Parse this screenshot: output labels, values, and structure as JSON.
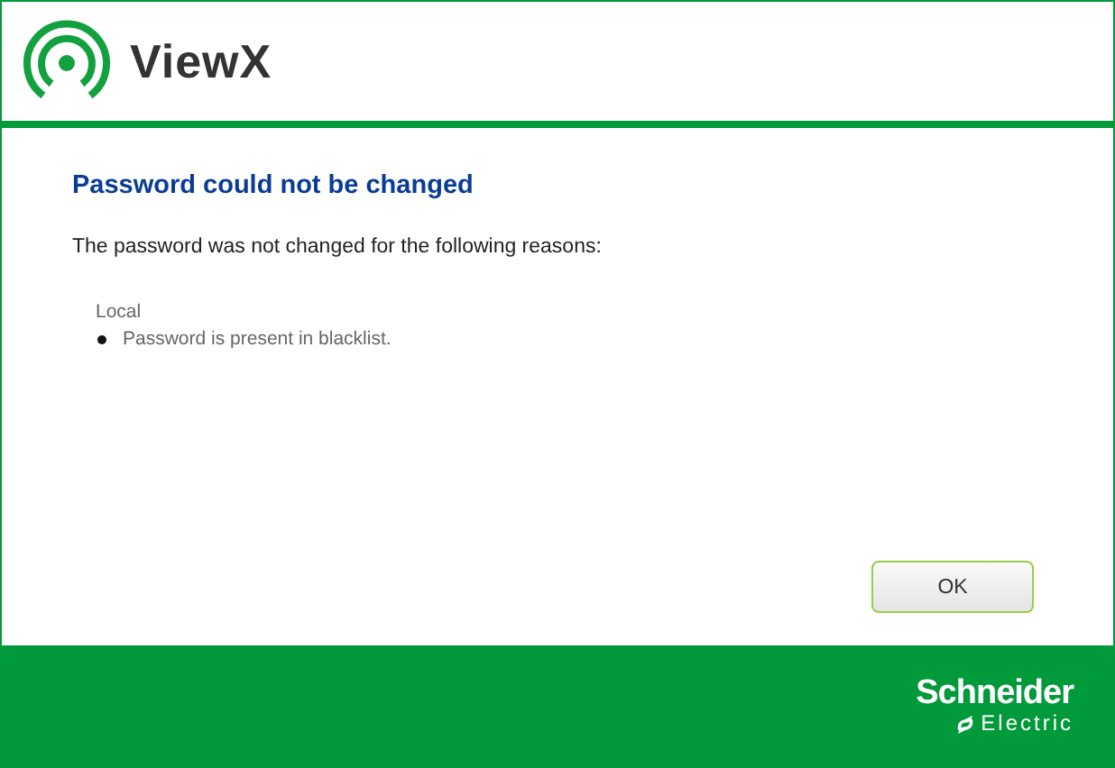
{
  "header": {
    "app_name": "ViewX"
  },
  "dialog": {
    "title": "Password could not be changed",
    "message": "The password was not changed for the following reasons:",
    "groups": [
      {
        "name": "Local",
        "reasons": [
          "Password is present in blacklist."
        ]
      }
    ],
    "buttons": [
      "OK"
    ]
  },
  "footer": {
    "brand_line_1": "Schneider",
    "brand_line_2": "Electric"
  }
}
